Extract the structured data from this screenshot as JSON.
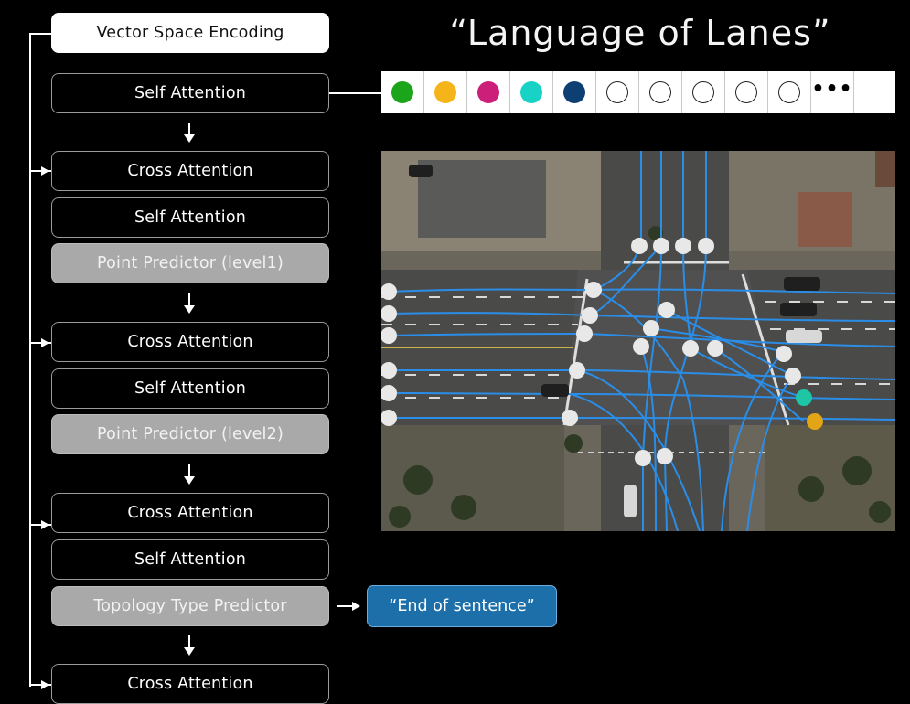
{
  "title": "“Language of Lanes”",
  "blocks": [
    {
      "label": "Vector Space Encoding",
      "style": "white"
    },
    {
      "label": "Self Attention",
      "style": "dark"
    },
    {
      "label": "Cross Attention",
      "style": "dark"
    },
    {
      "label": "Self Attention",
      "style": "dark"
    },
    {
      "label": "Point Predictor (level1)",
      "style": "gray"
    },
    {
      "label": "Cross Attention",
      "style": "dark"
    },
    {
      "label": "Self Attention",
      "style": "dark"
    },
    {
      "label": "Point Predictor (level2)",
      "style": "gray"
    },
    {
      "label": "Cross Attention",
      "style": "dark"
    },
    {
      "label": "Self Attention",
      "style": "dark"
    },
    {
      "label": "Topology Type Predictor",
      "style": "gray"
    },
    {
      "label": "Cross Attention",
      "style": "dark"
    }
  ],
  "end_token": "“End of sentence”",
  "token_sequence": {
    "filled_colors": [
      "#1aa51a",
      "#f4b41a",
      "#cc1f7a",
      "#18d2c6",
      "#0e3f73"
    ],
    "empty_count": 5,
    "ellipsis": "•••"
  },
  "colors": {
    "lane_line": "#2a8ee8",
    "node": "#e8e8e8",
    "node_teal": "#1fc6a6",
    "node_orange": "#e3a416",
    "end_token_bg": "#1c6fa8"
  }
}
